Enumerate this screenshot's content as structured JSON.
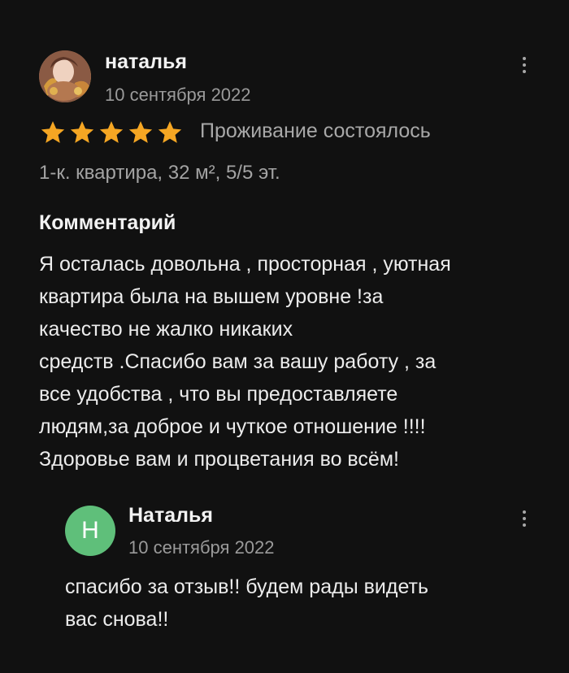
{
  "review": {
    "author_name": "наталья",
    "date": "10 сентября 2022",
    "rating": 5,
    "rating_max": 5,
    "stay_status": "Проживание состоялось",
    "apartment_info": "1-к. квартира, 32 м², 5/5 эт.",
    "comment_heading": "Комментарий",
    "comment_lines": [
      "Я осталась довольна , просторная , уютная",
      "квартира была на вышем уровне !за",
      "качество не жалко никаких",
      "средств .Спасибо вам за вашу работу , за",
      "все удобства , что вы предоставляете",
      "людям,за доброе и чуткое отношение !!!!",
      "Здоровье вам и процветания во всём!"
    ]
  },
  "reply": {
    "avatar_letter": "Н",
    "author_name": "Наталья",
    "date": "10 сентября 2022",
    "text_lines": [
      "спасибо за отзыв!! будем рады видеть",
      "вас снова!!"
    ]
  },
  "colors": {
    "background": "#111111",
    "star": "#f5a623",
    "reply_avatar": "#5fbf7a",
    "muted_text": "#9a9a9a"
  },
  "icons": {
    "more": "more-vertical-icon",
    "star": "star-icon"
  }
}
